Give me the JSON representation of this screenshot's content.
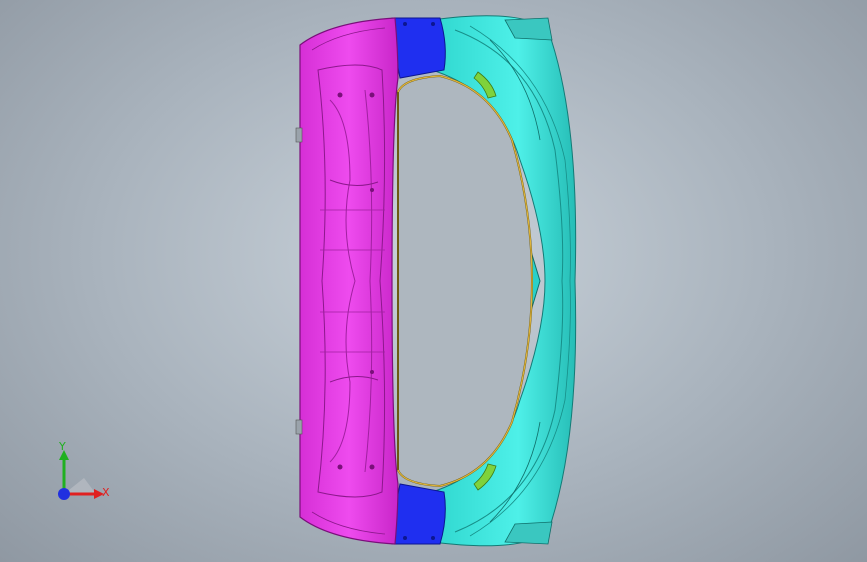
{
  "viewport": {
    "background": "#a9b3bd"
  },
  "model": {
    "colors": {
      "magenta": "#e63be6",
      "magenta_dark": "#b320b3",
      "blue": "#1f2ff0",
      "cyan": "#36e6dc",
      "cyan_dark": "#1faaa4",
      "orange": "#e08a2c",
      "green": "#7fd23c"
    }
  },
  "triad": {
    "x_label": "X",
    "y_label": "Y",
    "x_color": "#e02020",
    "y_color": "#20b020",
    "z_color": "#2030e0"
  }
}
